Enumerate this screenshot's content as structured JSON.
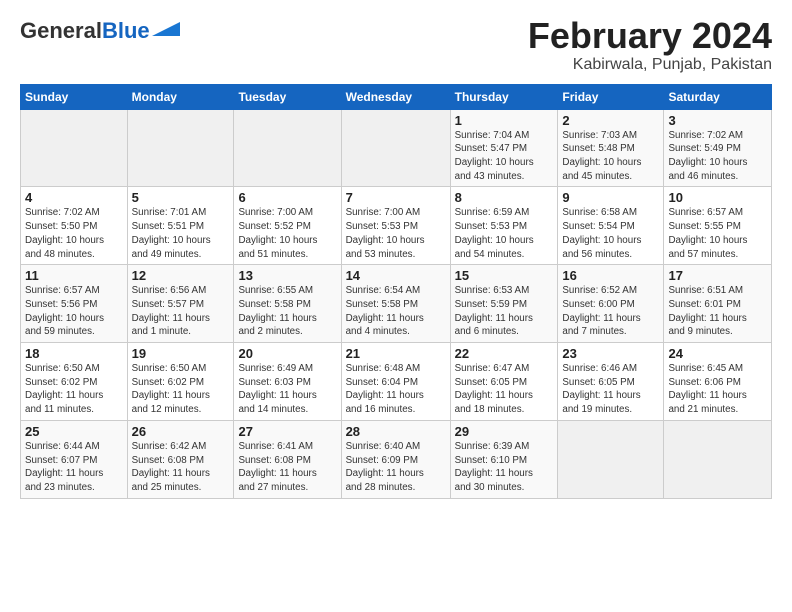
{
  "logo": {
    "line1": "General",
    "line2": "Blue"
  },
  "title": "February 2024",
  "subtitle": "Kabirwala, Punjab, Pakistan",
  "headers": [
    "Sunday",
    "Monday",
    "Tuesday",
    "Wednesday",
    "Thursday",
    "Friday",
    "Saturday"
  ],
  "weeks": [
    [
      {
        "num": "",
        "info": ""
      },
      {
        "num": "",
        "info": ""
      },
      {
        "num": "",
        "info": ""
      },
      {
        "num": "",
        "info": ""
      },
      {
        "num": "1",
        "info": "Sunrise: 7:04 AM\nSunset: 5:47 PM\nDaylight: 10 hours\nand 43 minutes."
      },
      {
        "num": "2",
        "info": "Sunrise: 7:03 AM\nSunset: 5:48 PM\nDaylight: 10 hours\nand 45 minutes."
      },
      {
        "num": "3",
        "info": "Sunrise: 7:02 AM\nSunset: 5:49 PM\nDaylight: 10 hours\nand 46 minutes."
      }
    ],
    [
      {
        "num": "4",
        "info": "Sunrise: 7:02 AM\nSunset: 5:50 PM\nDaylight: 10 hours\nand 48 minutes."
      },
      {
        "num": "5",
        "info": "Sunrise: 7:01 AM\nSunset: 5:51 PM\nDaylight: 10 hours\nand 49 minutes."
      },
      {
        "num": "6",
        "info": "Sunrise: 7:00 AM\nSunset: 5:52 PM\nDaylight: 10 hours\nand 51 minutes."
      },
      {
        "num": "7",
        "info": "Sunrise: 7:00 AM\nSunset: 5:53 PM\nDaylight: 10 hours\nand 53 minutes."
      },
      {
        "num": "8",
        "info": "Sunrise: 6:59 AM\nSunset: 5:53 PM\nDaylight: 10 hours\nand 54 minutes."
      },
      {
        "num": "9",
        "info": "Sunrise: 6:58 AM\nSunset: 5:54 PM\nDaylight: 10 hours\nand 56 minutes."
      },
      {
        "num": "10",
        "info": "Sunrise: 6:57 AM\nSunset: 5:55 PM\nDaylight: 10 hours\nand 57 minutes."
      }
    ],
    [
      {
        "num": "11",
        "info": "Sunrise: 6:57 AM\nSunset: 5:56 PM\nDaylight: 10 hours\nand 59 minutes."
      },
      {
        "num": "12",
        "info": "Sunrise: 6:56 AM\nSunset: 5:57 PM\nDaylight: 11 hours\nand 1 minute."
      },
      {
        "num": "13",
        "info": "Sunrise: 6:55 AM\nSunset: 5:58 PM\nDaylight: 11 hours\nand 2 minutes."
      },
      {
        "num": "14",
        "info": "Sunrise: 6:54 AM\nSunset: 5:58 PM\nDaylight: 11 hours\nand 4 minutes."
      },
      {
        "num": "15",
        "info": "Sunrise: 6:53 AM\nSunset: 5:59 PM\nDaylight: 11 hours\nand 6 minutes."
      },
      {
        "num": "16",
        "info": "Sunrise: 6:52 AM\nSunset: 6:00 PM\nDaylight: 11 hours\nand 7 minutes."
      },
      {
        "num": "17",
        "info": "Sunrise: 6:51 AM\nSunset: 6:01 PM\nDaylight: 11 hours\nand 9 minutes."
      }
    ],
    [
      {
        "num": "18",
        "info": "Sunrise: 6:50 AM\nSunset: 6:02 PM\nDaylight: 11 hours\nand 11 minutes."
      },
      {
        "num": "19",
        "info": "Sunrise: 6:50 AM\nSunset: 6:02 PM\nDaylight: 11 hours\nand 12 minutes."
      },
      {
        "num": "20",
        "info": "Sunrise: 6:49 AM\nSunset: 6:03 PM\nDaylight: 11 hours\nand 14 minutes."
      },
      {
        "num": "21",
        "info": "Sunrise: 6:48 AM\nSunset: 6:04 PM\nDaylight: 11 hours\nand 16 minutes."
      },
      {
        "num": "22",
        "info": "Sunrise: 6:47 AM\nSunset: 6:05 PM\nDaylight: 11 hours\nand 18 minutes."
      },
      {
        "num": "23",
        "info": "Sunrise: 6:46 AM\nSunset: 6:05 PM\nDaylight: 11 hours\nand 19 minutes."
      },
      {
        "num": "24",
        "info": "Sunrise: 6:45 AM\nSunset: 6:06 PM\nDaylight: 11 hours\nand 21 minutes."
      }
    ],
    [
      {
        "num": "25",
        "info": "Sunrise: 6:44 AM\nSunset: 6:07 PM\nDaylight: 11 hours\nand 23 minutes."
      },
      {
        "num": "26",
        "info": "Sunrise: 6:42 AM\nSunset: 6:08 PM\nDaylight: 11 hours\nand 25 minutes."
      },
      {
        "num": "27",
        "info": "Sunrise: 6:41 AM\nSunset: 6:08 PM\nDaylight: 11 hours\nand 27 minutes."
      },
      {
        "num": "28",
        "info": "Sunrise: 6:40 AM\nSunset: 6:09 PM\nDaylight: 11 hours\nand 28 minutes."
      },
      {
        "num": "29",
        "info": "Sunrise: 6:39 AM\nSunset: 6:10 PM\nDaylight: 11 hours\nand 30 minutes."
      },
      {
        "num": "",
        "info": ""
      },
      {
        "num": "",
        "info": ""
      }
    ]
  ]
}
